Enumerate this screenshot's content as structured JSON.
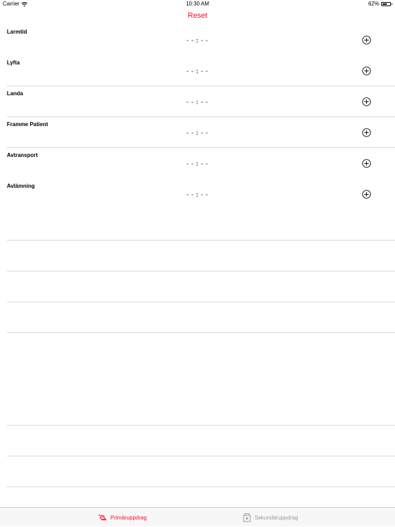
{
  "status_bar": {
    "carrier": "Carrier",
    "time": "10:30 AM",
    "battery": "62%",
    "battery_level": 0.62
  },
  "nav": {
    "reset_label": "Reset"
  },
  "rows": [
    {
      "label": "Larmtid",
      "value": "--:--"
    },
    {
      "label": "Lyfta",
      "value": "--:--"
    },
    {
      "label": "Landa",
      "value": "--:--"
    },
    {
      "label": "Framme Patient",
      "value": "--:--"
    },
    {
      "label": "Avtransport",
      "value": "--:--"
    },
    {
      "label": "Avlämning",
      "value": "--:--"
    }
  ],
  "tab_bar": {
    "tabs": [
      {
        "label": "Primäruppdrag",
        "icon": "helicopter-icon",
        "active": true
      },
      {
        "label": "Sekundäruppdrag",
        "icon": "ambulance-icon",
        "active": false
      }
    ]
  },
  "colors": {
    "accent": "#ff0a2b",
    "inactive": "#9a9a9a",
    "separator": "#d9d9dc"
  }
}
